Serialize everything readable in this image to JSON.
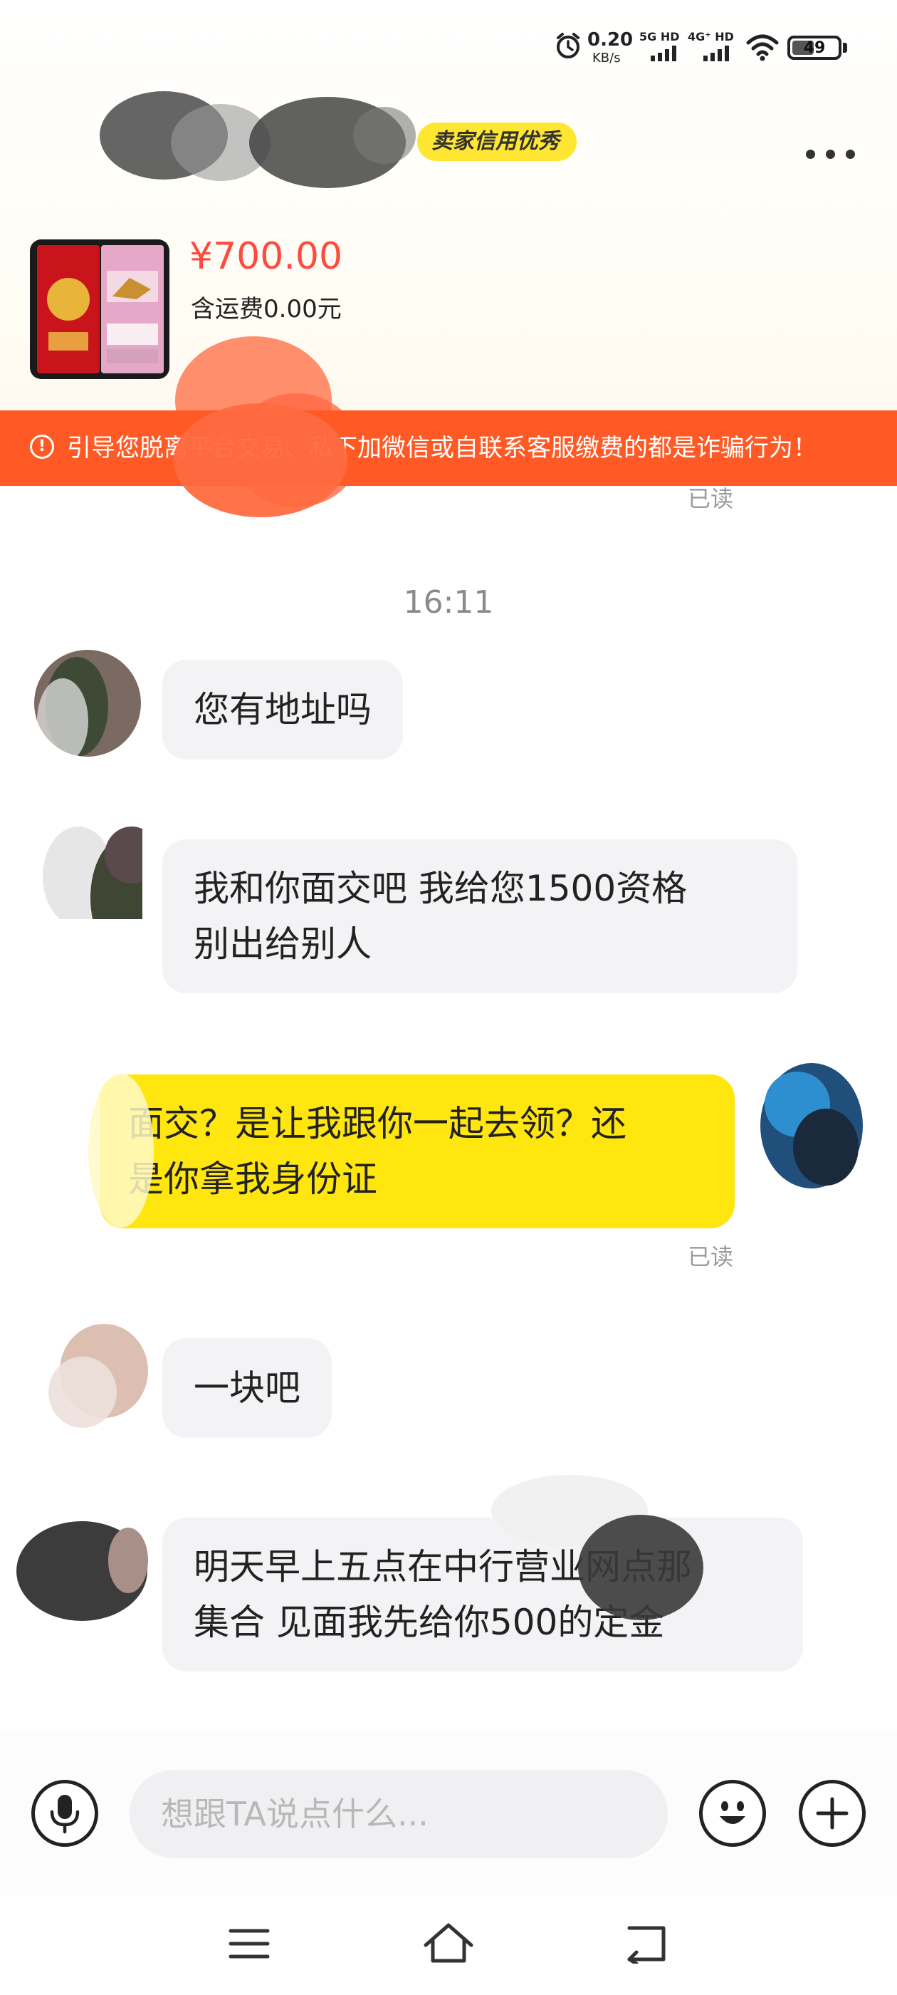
{
  "status_bar": {
    "net_speed": "0.20",
    "net_speed_unit": "KB/s",
    "signal_1": "5G HD",
    "signal_2": "4G⁺ HD",
    "battery": "49"
  },
  "header": {
    "seller_badge": "卖家信用优秀",
    "more_icon": "more-dots-icon"
  },
  "product": {
    "price": "¥700.00",
    "shipping": "含运费0.00元"
  },
  "warning": {
    "icon": "exclamation-circle-icon",
    "text": "引导您脱离平台交易、私下加微信或自联系客服缴费的都是诈骗行为！"
  },
  "chat": {
    "read_label": "已读",
    "time_separator": "16:11",
    "messages": [
      {
        "side": "other",
        "lines": [
          "您有地址吗"
        ]
      },
      {
        "side": "other",
        "lines": [
          "我和你面交吧 我给您1500资格",
          "别出给别人"
        ]
      },
      {
        "side": "self",
        "lines": [
          "面交？是让我跟你一起去领？还",
          "是你拿我身份证"
        ],
        "status": "已读"
      },
      {
        "side": "other",
        "lines": [
          "一块吧"
        ]
      },
      {
        "side": "other",
        "lines": [
          "明天早上五点在中行营业网点那",
          "集合 见面我先给你500的定金"
        ]
      }
    ]
  },
  "input_bar": {
    "mic_icon": "microphone-icon",
    "placeholder": "想跟TA说点什么...",
    "emoji_icon": "emoji-icon",
    "plus_icon": "plus-icon"
  },
  "nav": {
    "menu_icon": "menu-icon",
    "home_icon": "home-icon",
    "back_icon": "back-icon"
  },
  "colors": {
    "price": "#ff4a3d",
    "warning_bg": "#ff5a26",
    "self_bubble": "#ffe60f",
    "other_bubble": "#f3f3f5",
    "badge": "#ffe633"
  }
}
